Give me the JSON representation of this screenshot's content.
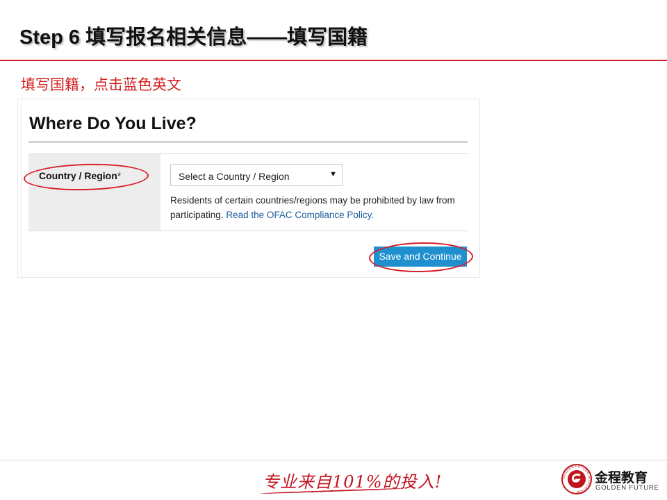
{
  "slide": {
    "title": "Step 6 填写报名相关信息——填写国籍",
    "instruction": "填写国籍，点击蓝色英文"
  },
  "form": {
    "heading": "Where Do You Live?",
    "field_label": "Country / Region",
    "required_mark": "*",
    "select_value": "Select a Country / Region",
    "select_caret": "▼",
    "help_text": "Residents of certain countries/regions may be prohibited by law from participating.",
    "help_link": "Read the OFAC Compliance Policy.",
    "save_button": "Save and Continue"
  },
  "footer": {
    "slogan": "专业来自101%的投入!",
    "brand_cn": "金程教育",
    "brand_en": "GOLDEN FUTURE",
    "logo_ring_text": "GOLDEN FUTURE EDUCATION"
  },
  "colors": {
    "accent_red": "#d11f1f",
    "button_blue": "#1f8fce",
    "link_blue": "#1a5a9a"
  }
}
